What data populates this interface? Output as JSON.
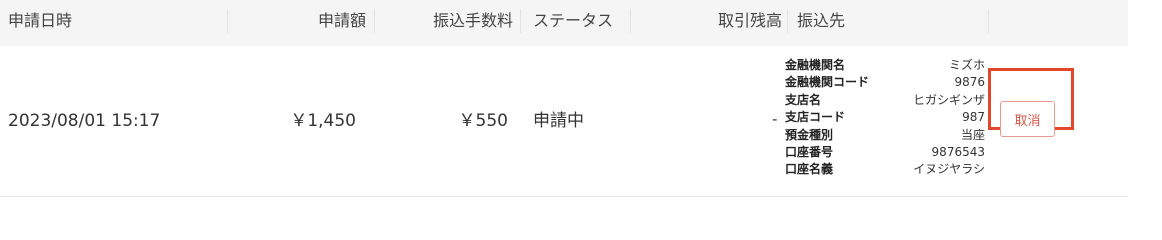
{
  "header": {
    "date_label": "申請日時",
    "amount_label": "申請額",
    "fee_label": "振込手数料",
    "status_label": "ステータス",
    "balance_label": "取引残高",
    "destination_label": "振込先"
  },
  "row": {
    "date": "2023/08/01 15:17",
    "amount": "￥1,450",
    "fee": "￥550",
    "status": "申請中",
    "balance": "-",
    "bank": [
      {
        "key": "金融機関名",
        "value": "ミズホ"
      },
      {
        "key": "金融機関コード",
        "value": "9876"
      },
      {
        "key": "支店名",
        "value": "ヒガシギンザ"
      },
      {
        "key": "支店コード",
        "value": "987"
      },
      {
        "key": "預金種別",
        "value": "当座"
      },
      {
        "key": "口座番号",
        "value": "9876543"
      },
      {
        "key": "口座名義",
        "value": "イヌジヤラシ"
      }
    ],
    "cancel_label": "取消"
  },
  "colors": {
    "header_bg": "#f5f5f5",
    "highlight": "#e2462d",
    "cancel_text": "#d9594a"
  }
}
